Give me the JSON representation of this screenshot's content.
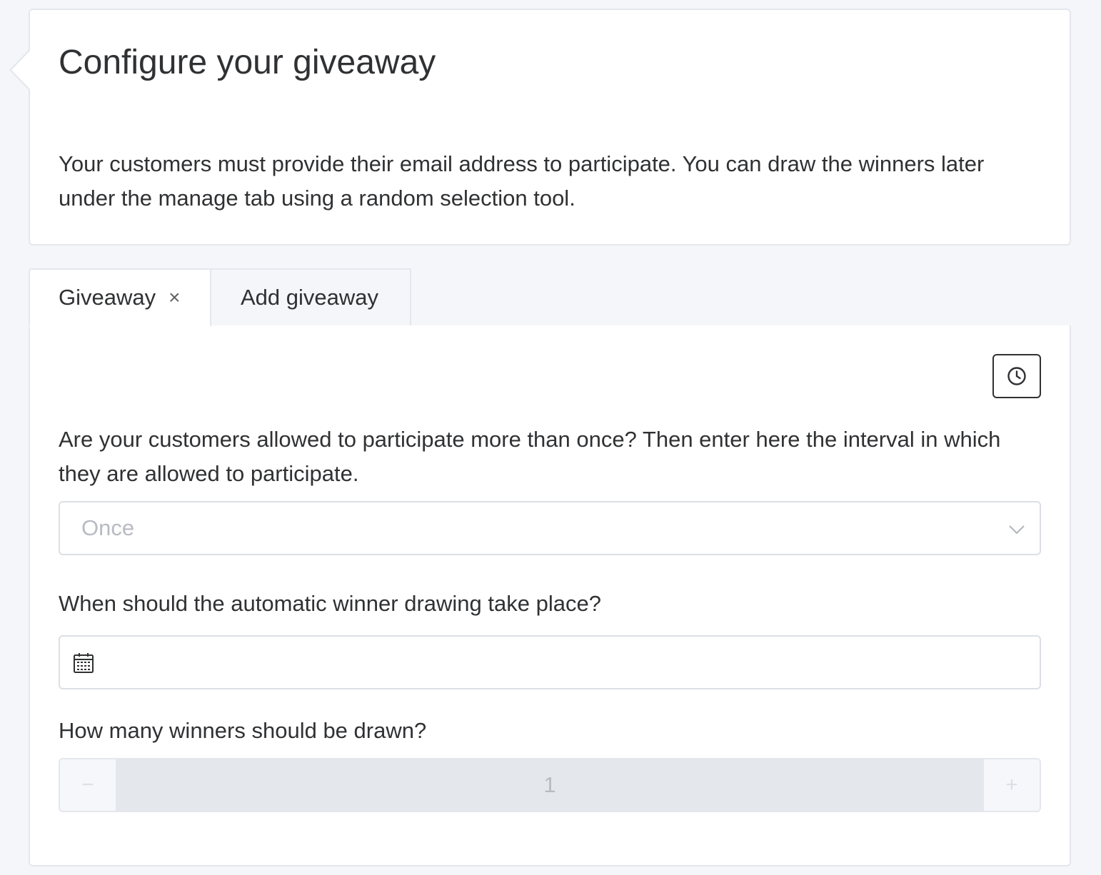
{
  "info": {
    "title": "Configure your giveaway",
    "description": "Your customers must provide their email address to participate. You can draw the winners later under the manage tab using a random selection tool."
  },
  "tabs": [
    {
      "label": "Giveaway",
      "active": true,
      "closable": true,
      "close_icon": "close-icon"
    },
    {
      "label": "Add giveaway",
      "active": false
    }
  ],
  "tab_close_glyph": "×",
  "toolbar": {
    "clock_icon": "clock-icon"
  },
  "form": {
    "interval_question": "Are your customers allowed to participate more than once? Then enter here the interval in which they are allowed to participate.",
    "interval_select": {
      "value": "Once",
      "icon": "chevron-down-icon"
    },
    "drawing_question": "When should the automatic winner drawing take place?",
    "drawing_date": {
      "value": "",
      "icon": "calendar-icon"
    },
    "winners_question": "How many winners should be drawn?",
    "winners_stepper": {
      "value": "1",
      "minus_label": "−",
      "plus_label": "+"
    }
  },
  "colors": {
    "page_background": "#f5f6fa",
    "card_background": "#ffffff",
    "border": "#e4e7ed",
    "text": "#303133",
    "placeholder": "#b8bbc2"
  }
}
